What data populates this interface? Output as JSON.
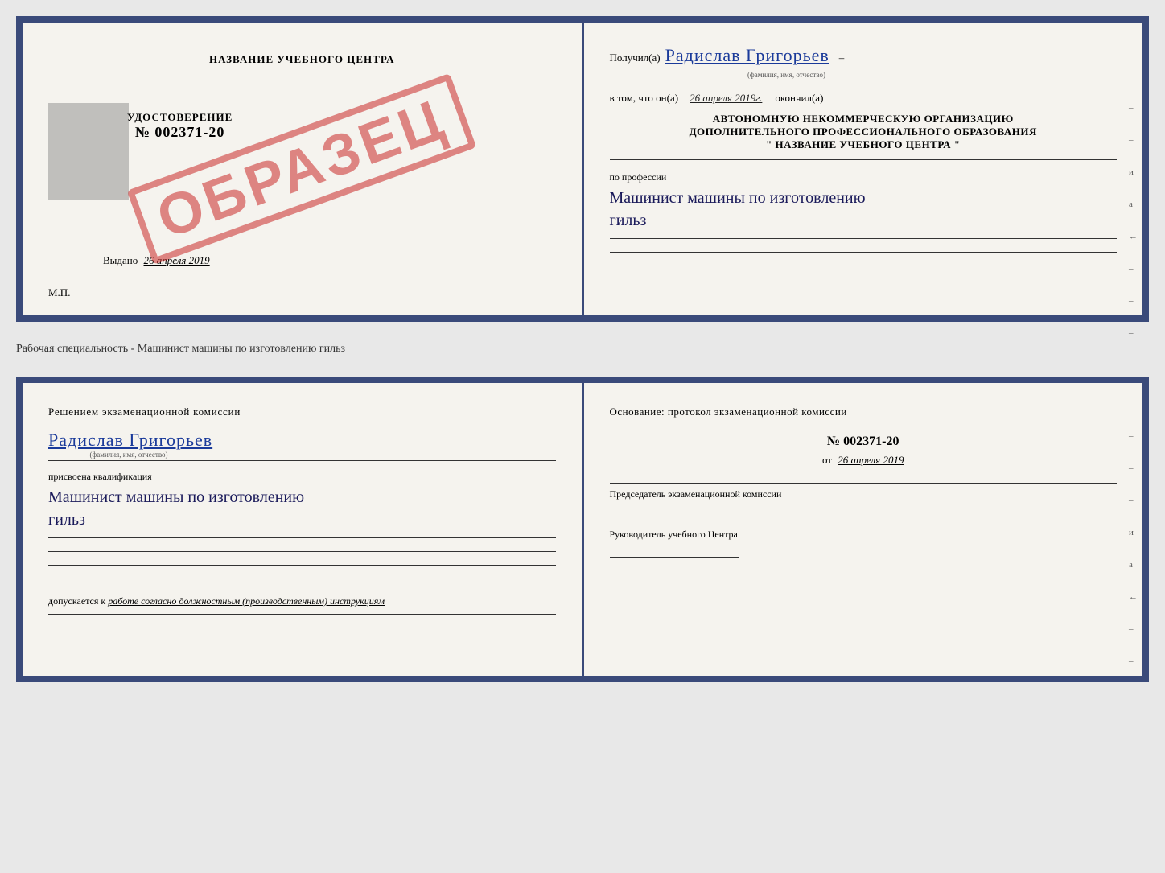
{
  "top_doc": {
    "left": {
      "center_name": "НАЗВАНИЕ УЧЕБНОГО ЦЕНТРА",
      "stamp": "ОБРАЗЕЦ",
      "udostoverenie_title": "УДОСТОВЕРЕНИЕ",
      "udostoverenie_number": "№ 002371-20",
      "vydano_label": "Выдано",
      "vydano_date": "26 апреля 2019",
      "mp_label": "М.П."
    },
    "right": {
      "poluchil_label": "Получил(a)",
      "recipient_name": "Радислав Григорьев",
      "fio_label": "(фамилия, имя, отчество)",
      "dash": "–",
      "vtom_label": "в том, что он(а)",
      "date_value": "26 апреля 2019г.",
      "okonchil_label": "окончил(а)",
      "org_line1": "АВТОНОМНУЮ НЕКОММЕРЧЕСКУЮ ОРГАНИЗАЦИЮ",
      "org_line2": "ДОПОЛНИТЕЛЬНОГО ПРОФЕССИОНАЛЬНОГО ОБРАЗОВАНИЯ",
      "org_line3": "\"   НАЗВАНИЕ УЧЕБНОГО ЦЕНТРА   \"",
      "po_professii_label": "по профессии",
      "profession_line1": "Машинист машины по изготовлению",
      "profession_line2": "гильз",
      "right_marks": [
        "–",
        "–",
        "–",
        "и",
        "а",
        "←",
        "–",
        "–",
        "–"
      ]
    }
  },
  "specialty_label": "Рабочая специальность - Машинист машины по изготовлению гильз",
  "bottom_doc": {
    "left": {
      "resheniem_label": "Решением  экзаменационной  комиссии",
      "recipient_name": "Радислав Григорьев",
      "fio_label": "(фамилия, имя, отчество)",
      "prisvoena_label": "присвоена квалификация",
      "qualification_line1": "Машинист  машины  по  изготовлению",
      "qualification_line2": "гильз",
      "dopuskaetsya_label": "допускается к",
      "dopusk_italic": "работе согласно должностным (производственным) инструкциям"
    },
    "right": {
      "osnovanie_label": "Основание:  протокол  экзаменационной  комиссии",
      "protocol_number": "№  002371-20",
      "ot_label": "от",
      "ot_date": "26 апреля 2019",
      "predsedatel_label": "Председатель экзаменационной комиссии",
      "rukovoditel_label": "Руководитель учебного Центра",
      "right_marks": [
        "–",
        "–",
        "–",
        "и",
        "а",
        "←",
        "–",
        "–",
        "–"
      ]
    }
  }
}
